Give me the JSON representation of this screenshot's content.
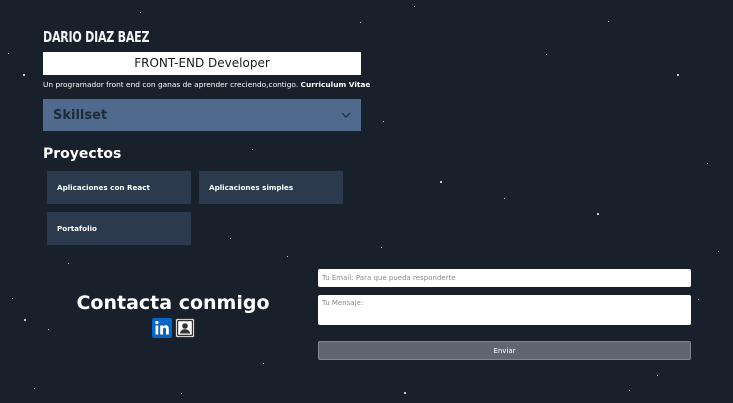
{
  "header": {
    "name": "DARIO DIAZ BAEZ",
    "role": "FRONT-END Developer",
    "tagline_text": "Un programador front end con ganas de aprender creciendo,contigo.",
    "cv_link": "Curriculum Vitae"
  },
  "skillset": {
    "label": "Skillset",
    "icon": "chevron-down-icon"
  },
  "projects": {
    "title": "Proyectos",
    "items": [
      {
        "label": "Aplicaciones con React"
      },
      {
        "label": "Aplicaciones simples"
      },
      {
        "label": "Portafolio"
      }
    ]
  },
  "contact": {
    "title": "Contacta conmigo",
    "icons": [
      "linkedin-icon",
      "contact-card-icon"
    ],
    "email_placeholder": "Tu Email: Para que pueda responderte",
    "message_placeholder": "Tu Mensaje:",
    "send_label": "Enviar"
  },
  "colors": {
    "background": "#18202b",
    "skillset": "#4f6a8c",
    "project_card": "#2b3a4c",
    "linkedin": "#0a66c2",
    "send_button": "#5e6672"
  }
}
